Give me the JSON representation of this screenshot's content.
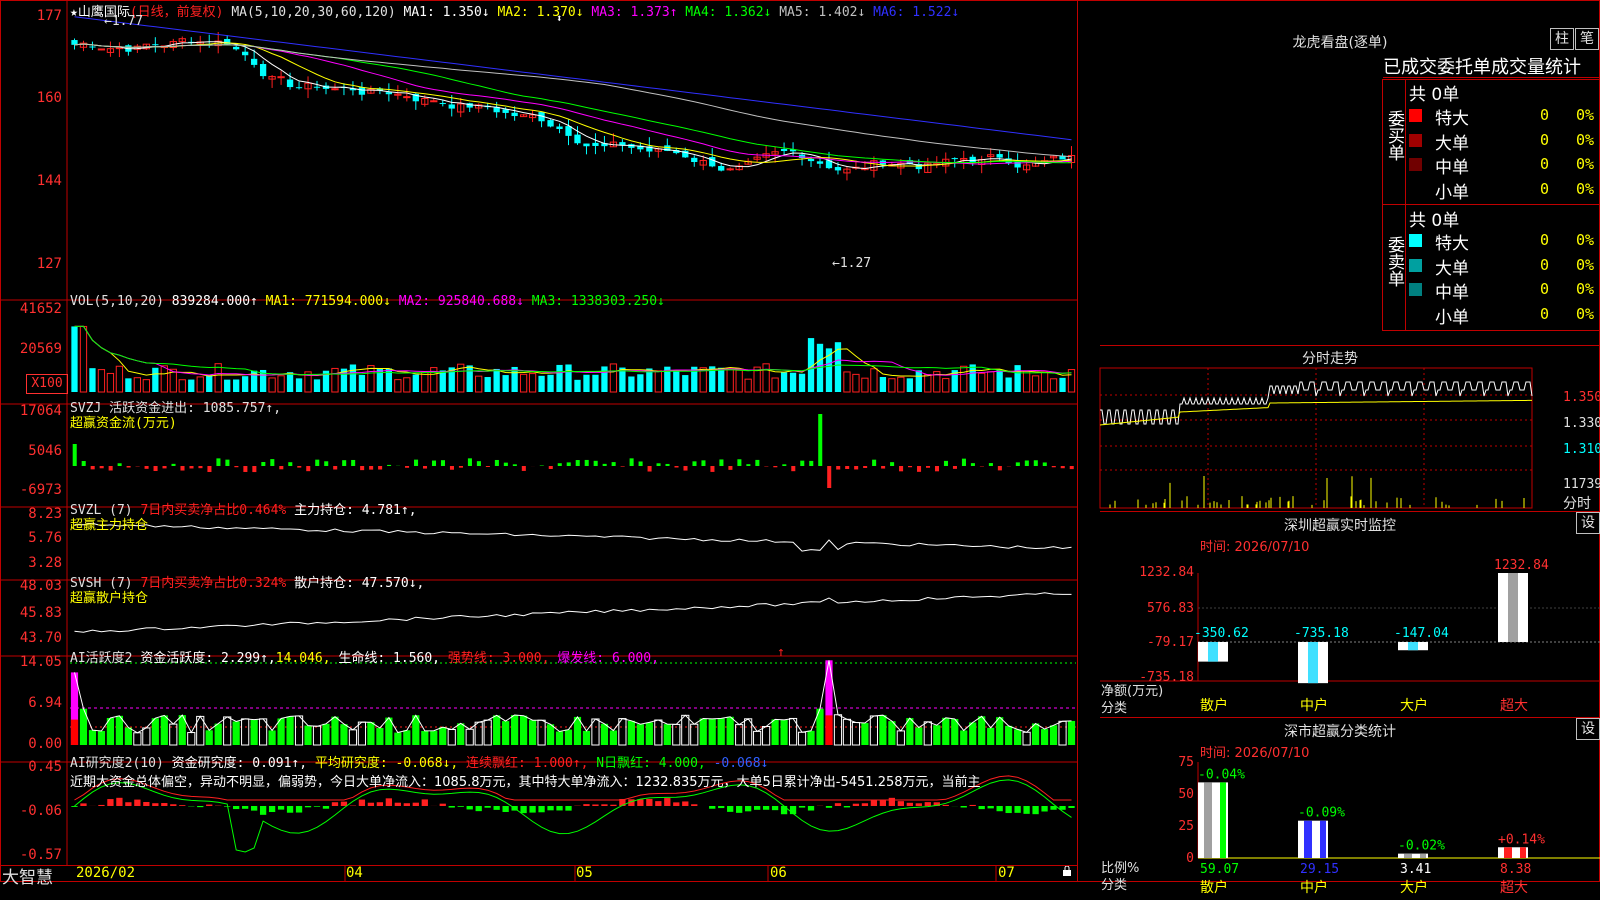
{
  "main_panel": {
    "title_star": "★",
    "title_name": "山鹰国际",
    "title_period": "(日线，前复权)",
    "ma_params": "MA(5,10,20,30,60,120)",
    "ma_values": [
      {
        "label": "MA1: 1.350↓",
        "color": "#ffffff"
      },
      {
        "label": "MA2: 1.370↓",
        "color": "#ffff00"
      },
      {
        "label": "MA3: 1.373↑",
        "color": "#ff00ff"
      },
      {
        "label": "MA4: 1.362↓",
        "color": "#00ff00"
      },
      {
        "label": "MA5: 1.402↓",
        "color": "#c0c0c0"
      },
      {
        "label": "MA6: 1.522↓",
        "color": "#3030ff"
      }
    ],
    "y_ticks": [
      "177",
      "160",
      "144",
      "127"
    ],
    "high_note": "←1.77",
    "low_note": "←1.27",
    "cursor_glyph": "⬍"
  },
  "vol_panel": {
    "title": "VOL(5,10,20)",
    "value": "839284.000↑",
    "ma1": "MA1: 771594.000↓",
    "ma2": "MA2: 925840.688↓",
    "ma3": "MA3: 1338303.250↓",
    "y_ticks": [
      "41652",
      "20569"
    ],
    "unit_label": "X100"
  },
  "svzj_panel": {
    "title": "SVZJ",
    "line1": "活跃资金进出: 1085.757↑,",
    "line2": "超赢资金流(万元)",
    "y_ticks": [
      "17064",
      "5046",
      "-6973"
    ]
  },
  "svzl_panel": {
    "title": "SVZL (7)",
    "ratio": "7日内买卖净占比0.464%",
    "hold": "主力持仓: 4.781↑,",
    "line2": "超赢主力持仓",
    "y_ticks": [
      "8.23",
      "5.76",
      "3.28"
    ]
  },
  "svsh_panel": {
    "title": "SVSH (7)",
    "ratio": "7日内买卖净占比0.324%",
    "hold": "散户持仓: 47.570↓,",
    "line2": "超赢散户持仓",
    "y_ticks": [
      "48.03",
      "45.83",
      "43.70"
    ]
  },
  "ai_active_panel": {
    "title": "AI活跃度2",
    "activity": "资金活跃度: 2.299↑,",
    "v2": "14.046,",
    "life": "生命线: 1.560,",
    "strong": "强势线: 3.000,",
    "burst": "爆发线: 6.000,",
    "y_ticks": [
      "14.05",
      "6.94",
      "0.00"
    ],
    "arrow": "↑"
  },
  "ai_research_panel": {
    "title": "AI研究度2(10)",
    "research": "资金研究度: 0.091↑,",
    "avg": "平均研究度: -0.068↓,",
    "streak": "连续飘红: 1.000↑,",
    "nday": "N日飘红: 4.000,",
    "last": "-0.068↓",
    "comment": "近期大资金总体偏空，异动不明显，偏弱势，今日大单净流入：1085.8万元，其中特大单净流入：1232.835万元，大单5日累计净出-5451.258万元，当前主",
    "y_ticks": [
      "0.45",
      "-0.06",
      "-0.57"
    ]
  },
  "bottom_bar": {
    "brand": "大智慧",
    "dates": [
      "2026/02",
      "04",
      "05",
      "06",
      "07"
    ]
  },
  "dragon_tiger": {
    "header": "龙虎看盘(逐单)",
    "btn_zhu": "柱",
    "btn_bi": "笔",
    "subtitle": "已成交委托单成交量统计",
    "buy_label": "委买单",
    "sell_label": "委卖单",
    "buy_total": "共 0单",
    "sell_total": "共 0单",
    "buy_rows": [
      {
        "name": "特大",
        "count": "0",
        "pct": "0%",
        "color": "#ff0000"
      },
      {
        "name": "大单",
        "count": "0",
        "pct": "0%",
        "color": "#a00000"
      },
      {
        "name": "中单",
        "count": "0",
        "pct": "0%",
        "color": "#700000"
      },
      {
        "name": "小单",
        "count": "0",
        "pct": "0%",
        "color": "#000000"
      }
    ],
    "sell_rows": [
      {
        "name": "特大",
        "count": "0",
        "pct": "0%",
        "color": "#00ffff"
      },
      {
        "name": "大单",
        "count": "0",
        "pct": "0%",
        "color": "#00a0a0"
      },
      {
        "name": "中单",
        "count": "0",
        "pct": "0%",
        "color": "#008080"
      },
      {
        "name": "小单",
        "count": "0",
        "pct": "0%",
        "color": "#000000"
      }
    ]
  },
  "intraday": {
    "header": "分时走势",
    "prices": [
      "1.350",
      "1.330",
      "1.310"
    ],
    "vol_tick": "11739",
    "tag": "分时"
  },
  "sz_monitor": {
    "header": "深圳超赢实时监控",
    "btn": "设",
    "time_label": "时间: 2026/07/10",
    "y_ticks": [
      "1232.84",
      "576.83",
      "-79.17",
      "-735.18"
    ],
    "unit": "净额(万元)",
    "cat_label": "分类",
    "categories": [
      "散户",
      "中户",
      "大户",
      "超大"
    ],
    "values": [
      -350.62,
      -735.18,
      -147.04,
      1232.84
    ],
    "value_labels": [
      "-350.62",
      "-735.18",
      "-147.04",
      "1232.84"
    ]
  },
  "sz_class": {
    "header": "深市超赢分类统计",
    "btn": "设",
    "time_label": "时间: 2026/07/10",
    "y_ticks": [
      "75",
      "50",
      "25",
      "0"
    ],
    "unit": "比例%",
    "cat_label": "分类",
    "categories": [
      "散户",
      "中户",
      "大户",
      "超大"
    ],
    "values": [
      59.07,
      29.15,
      3.41,
      8.38
    ],
    "value_labels": [
      "59.07",
      "29.15",
      "3.41",
      "8.38"
    ],
    "change_labels": [
      "-0.04%",
      "-0.09%",
      "-0.02%",
      "+0.14%"
    ]
  }
}
